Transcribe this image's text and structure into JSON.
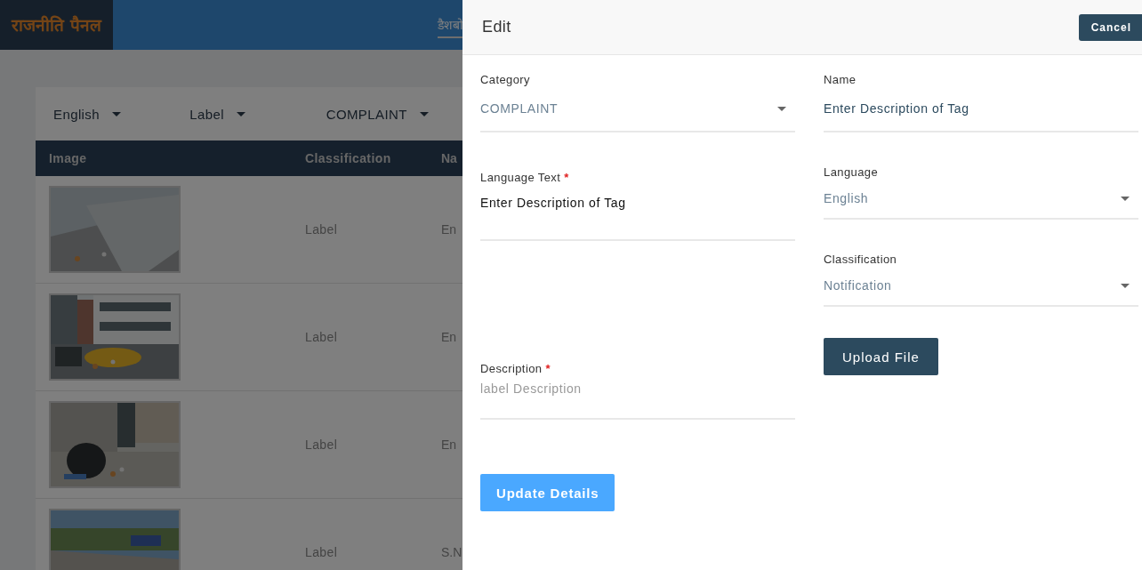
{
  "header": {
    "brand": "राजनीति पैनल",
    "nav": [
      {
        "label": "डैशबो",
        "selected": true
      }
    ]
  },
  "filters": [
    {
      "value": "English"
    },
    {
      "value": "Label"
    },
    {
      "value": "COMPLAINT"
    }
  ],
  "table": {
    "columns": [
      "Image",
      "Classification",
      "Na"
    ],
    "rows": [
      {
        "classification": "Label",
        "name": "En"
      },
      {
        "classification": "Label",
        "name": "En"
      },
      {
        "classification": "Label",
        "name": "En"
      },
      {
        "classification": "Label",
        "name": "S.N"
      }
    ]
  },
  "drawer": {
    "title": "Edit",
    "cancel": "Cancel",
    "left": [
      {
        "kind": "select",
        "label": "Category",
        "value": "COMPLAINT"
      },
      {
        "kind": "input",
        "label": "Language Text",
        "required_mark": "*",
        "value": "Enter Description of Tag"
      },
      {
        "kind": "input",
        "label": "Description",
        "required_mark": "*",
        "placeholder": "label Description"
      }
    ],
    "right": [
      {
        "kind": "input",
        "label": "Name",
        "value": "Enter Description of Tag"
      },
      {
        "kind": "select",
        "label": "Language",
        "value": "English"
      },
      {
        "kind": "select",
        "label": "Classification",
        "value": "Notification"
      }
    ],
    "upload": "Upload File",
    "submit": "Update Details"
  }
}
